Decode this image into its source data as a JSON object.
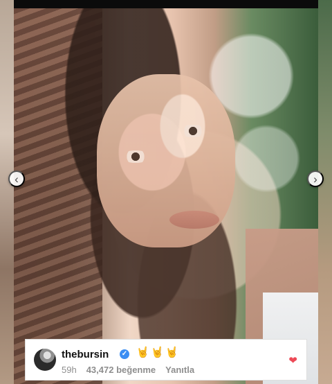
{
  "post": {
    "navigation": {
      "previous_icon": "chevron-left-icon",
      "next_icon": "chevron-right-icon",
      "previous_glyph": "‹",
      "next_glyph": "›"
    },
    "comment": {
      "username": "thebursin",
      "verified_icon": "verified-icon",
      "verified_glyph": "✓",
      "emoji_1": "🤘",
      "emoji_2": "🤘",
      "emoji_3": "🤘",
      "time": "59h",
      "likes": "43,472 beğenme",
      "reply": "Yanıtla",
      "heart_icon": "heart-icon",
      "heart_glyph": "❤",
      "heart_color": "#ed4956",
      "verified_color": "#3b8ef3"
    }
  }
}
